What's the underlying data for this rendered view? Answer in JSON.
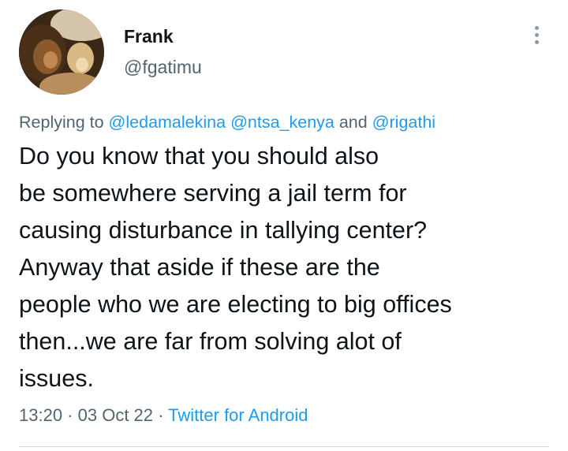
{
  "user": {
    "display_name": "Frank",
    "handle": "@fgatimu"
  },
  "reply_context": {
    "prefix": "Replying to ",
    "mentions": [
      "@ledamalekina",
      "@ntsa_kenya",
      "@rigathi"
    ],
    "separator": " ",
    "conjunction": " and "
  },
  "tweet": {
    "lines": [
      "Do you know that you should also",
      "be somewhere serving a jail term for",
      "causing disturbance in tallying center?",
      "Anyway that aside if these are the",
      "people who we are electing to big offices",
      "then...we are far from solving alot of",
      "issues."
    ]
  },
  "meta": {
    "time": "13:20",
    "dot": " · ",
    "date": "03 Oct 22",
    "source": "Twitter for Android"
  },
  "colors": {
    "accent": "#1d9bf0",
    "secondary_text": "#536471",
    "primary_text": "#0f1419"
  },
  "icons": {
    "more": "more-vertical-icon",
    "avatar": "lion-photo"
  }
}
